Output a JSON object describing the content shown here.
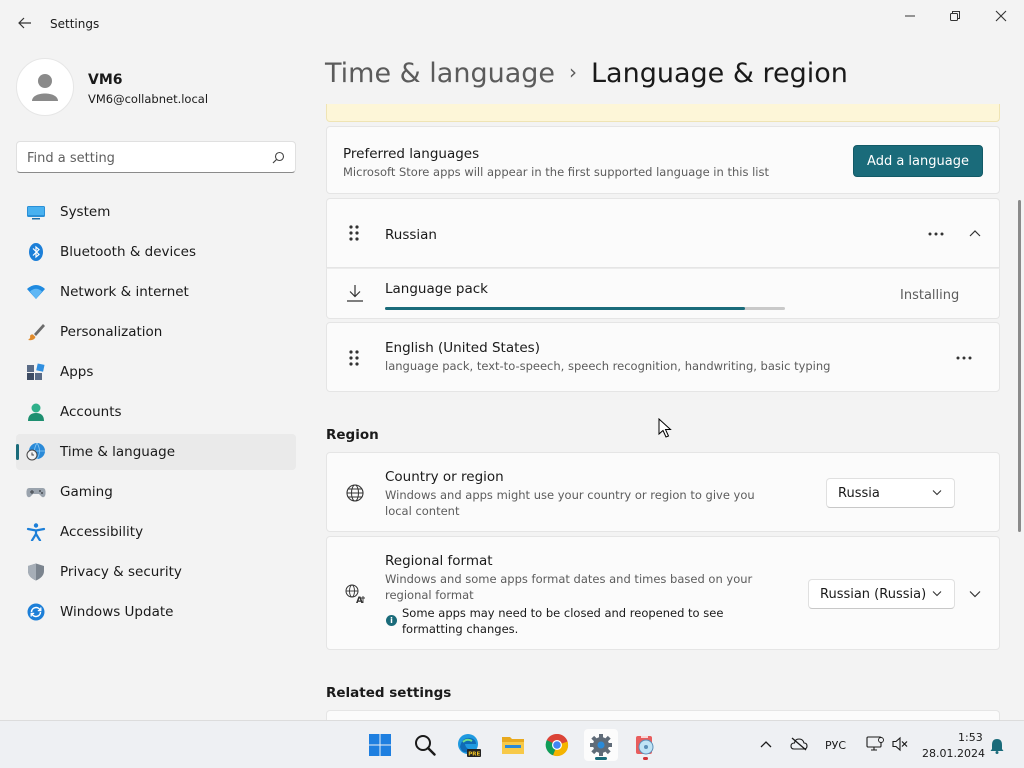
{
  "window": {
    "title": "Settings"
  },
  "profile": {
    "name": "VM6",
    "email": "VM6@collabnet.local"
  },
  "search": {
    "placeholder": "Find a setting"
  },
  "sidebar": {
    "items": [
      {
        "label": "System",
        "icon": "system-icon"
      },
      {
        "label": "Bluetooth & devices",
        "icon": "bluetooth-icon"
      },
      {
        "label": "Network & internet",
        "icon": "wifi-icon"
      },
      {
        "label": "Personalization",
        "icon": "brush-icon"
      },
      {
        "label": "Apps",
        "icon": "apps-icon"
      },
      {
        "label": "Accounts",
        "icon": "person-icon"
      },
      {
        "label": "Time & language",
        "icon": "globe-clock-icon"
      },
      {
        "label": "Gaming",
        "icon": "gamepad-icon"
      },
      {
        "label": "Accessibility",
        "icon": "accessibility-icon"
      },
      {
        "label": "Privacy & security",
        "icon": "shield-icon"
      },
      {
        "label": "Windows Update",
        "icon": "sync-icon"
      }
    ],
    "active_index": 6
  },
  "breadcrumb": {
    "parent": "Time & language",
    "separator": "›",
    "current": "Language & region"
  },
  "preferred_languages": {
    "title": "Preferred languages",
    "description": "Microsoft Store apps will appear in the first supported language in this list",
    "add_button": "Add a language"
  },
  "languages": [
    {
      "name": "Russian",
      "expanded": true,
      "pack": {
        "label": "Language pack",
        "status": "Installing",
        "progress_fraction": 0.9
      }
    },
    {
      "name": "English (United States)",
      "features": "language pack, text-to-speech, speech recognition, handwriting, basic typing"
    }
  ],
  "region": {
    "section_title": "Region",
    "country": {
      "title": "Country or region",
      "description": "Windows and apps might use your country or region to give you local content",
      "value": "Russia"
    },
    "format": {
      "title": "Regional format",
      "description": "Windows and some apps format dates and times based on your regional format",
      "value": "Russian (Russia)",
      "notice": "Some apps may need to be closed and reopened to see formatting changes."
    }
  },
  "related": {
    "section_title": "Related settings"
  },
  "taskbar": {
    "apps": [
      "windows-start-icon",
      "search-icon",
      "edge-preview-icon",
      "file-explorer-icon",
      "chrome-icon",
      "settings-icon",
      "media-player-icon"
    ],
    "input_language": "РУС",
    "time": "1:53",
    "date": "28.01.2024"
  },
  "colors": {
    "accent": "#1a6b7a",
    "warning_bg": "#fdf6d8",
    "window_bg": "#f3f3f3",
    "card_bg": "#fbfbfb"
  }
}
